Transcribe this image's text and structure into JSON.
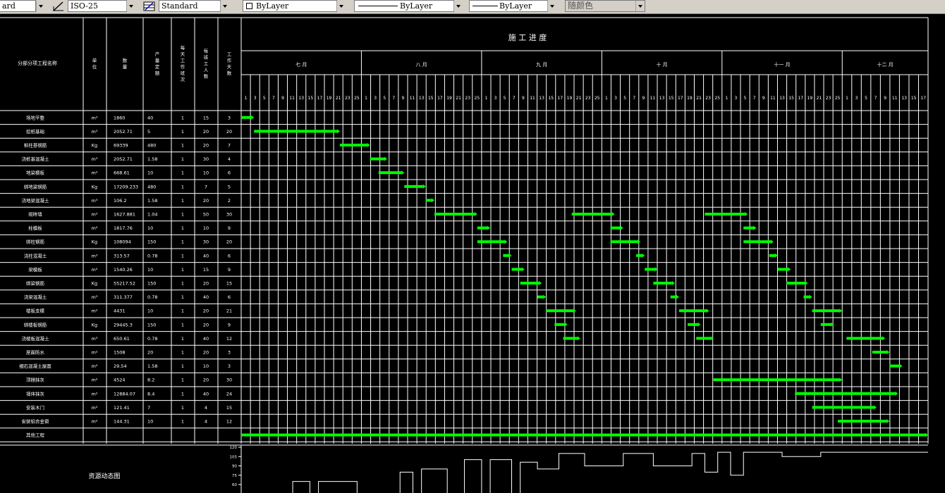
{
  "toolbar": {
    "text_style": "ard",
    "dim_style": "ISO-25",
    "table_style": "Standard",
    "layer": "ByLayer",
    "linetype": "ByLayer",
    "lineweight": "ByLayer",
    "color": "随颜色"
  },
  "schedule": {
    "title": "施 工 进 度",
    "headers": {
      "task": "分部分项工程名称",
      "unit": "单位",
      "qty": "数量",
      "rate": "产量定额",
      "shifts": "每天工作班次",
      "workers": "每班工人数",
      "days": "工作天数"
    },
    "months": [
      "七 月",
      "八 月",
      "九 月",
      "十 月",
      "十一 月",
      "十二 月"
    ],
    "day_labels": {
      "july": [
        "1",
        "3",
        "5",
        "7",
        "9",
        "11",
        "13",
        "15",
        "17",
        "19",
        "21",
        "23",
        "25"
      ],
      "aug": [
        "1",
        "3",
        "5",
        "7",
        "9",
        "11",
        "13",
        "15",
        "17",
        "19",
        "21",
        "23",
        "25"
      ],
      "sep": [
        "1",
        "3",
        "5",
        "7",
        "9",
        "11",
        "13",
        "15",
        "17",
        "19",
        "21",
        "23",
        "25"
      ],
      "oct": [
        "1",
        "3",
        "5",
        "7",
        "9",
        "11",
        "13",
        "15",
        "17",
        "19",
        "21",
        "23",
        "25"
      ],
      "nov": [
        "1",
        "3",
        "5",
        "7",
        "9",
        "11",
        "13",
        "15",
        "17",
        "19",
        "21",
        "23",
        "25"
      ],
      "dec": [
        "1",
        "3",
        "5",
        "7",
        "9",
        "11",
        "13",
        "15",
        "17"
      ]
    },
    "rows": [
      {
        "task": "场地平整",
        "unit": "m³",
        "qty": "1860",
        "rate": "40",
        "shifts": "1",
        "workers": "15",
        "days": "3"
      },
      {
        "task": "挖桩基础",
        "unit": "m³",
        "qty": "2052.71",
        "rate": "5",
        "shifts": "1",
        "workers": "20",
        "days": "20"
      },
      {
        "task": "桩柱基钢筋",
        "unit": "Kg",
        "qty": "69339",
        "rate": "480",
        "shifts": "1",
        "workers": "20",
        "days": "7"
      },
      {
        "task": "浇桩基混凝土",
        "unit": "m³",
        "qty": "2052.71",
        "rate": "1.58",
        "shifts": "1",
        "workers": "30",
        "days": "4"
      },
      {
        "task": "地梁模板",
        "unit": "m²",
        "qty": "668.61",
        "rate": "10",
        "shifts": "1",
        "workers": "10",
        "days": "6"
      },
      {
        "task": "绑地梁钢筋",
        "unit": "Kg",
        "qty": "17209.233",
        "rate": "480",
        "shifts": "1",
        "workers": "7",
        "days": "5"
      },
      {
        "task": "浇地梁混凝土",
        "unit": "m³",
        "qty": "106.2",
        "rate": "1.58",
        "shifts": "1",
        "workers": "20",
        "days": "2"
      },
      {
        "task": "砌砖墙",
        "unit": "m³",
        "qty": "1627.881",
        "rate": "1.04",
        "shifts": "1",
        "workers": "50",
        "days": "30"
      },
      {
        "task": "柱模板",
        "unit": "m²",
        "qty": "1817.76",
        "rate": "10",
        "shifts": "1",
        "workers": "10",
        "days": "9"
      },
      {
        "task": "绑柱钢筋",
        "unit": "Kg",
        "qty": "108094",
        "rate": "150",
        "shifts": "1",
        "workers": "30",
        "days": "20"
      },
      {
        "task": "浇柱混凝土",
        "unit": "m³",
        "qty": "313.57",
        "rate": "0.78",
        "shifts": "1",
        "workers": "40",
        "days": "6"
      },
      {
        "task": "梁模板",
        "unit": "m²",
        "qty": "1540.26",
        "rate": "10",
        "shifts": "1",
        "workers": "15",
        "days": "9"
      },
      {
        "task": "绑梁钢筋",
        "unit": "Kg",
        "qty": "55217.52",
        "rate": "150",
        "shifts": "1",
        "workers": "20",
        "days": "15"
      },
      {
        "task": "浇梁混凝土",
        "unit": "m³",
        "qty": "311.377",
        "rate": "0.78",
        "shifts": "1",
        "workers": "40",
        "days": "6"
      },
      {
        "task": "楼板支模",
        "unit": "m²",
        "qty": "4431",
        "rate": "10",
        "shifts": "1",
        "workers": "20",
        "days": "21"
      },
      {
        "task": "绑楼板钢筋",
        "unit": "Kg",
        "qty": "29445.3",
        "rate": "150",
        "shifts": "1",
        "workers": "20",
        "days": "9"
      },
      {
        "task": "浇楼板混凝土",
        "unit": "m³",
        "qty": "650.61",
        "rate": "0.78",
        "shifts": "1",
        "workers": "40",
        "days": "12"
      },
      {
        "task": "屋面防水",
        "unit": "m²",
        "qty": "1508",
        "rate": "20",
        "shifts": "1",
        "workers": "20",
        "days": "3"
      },
      {
        "task": "细石混凝土屋面",
        "unit": "m²",
        "qty": "29.54",
        "rate": "1.58",
        "shifts": "1",
        "workers": "10",
        "days": "3"
      },
      {
        "task": "顶棚抹灰",
        "unit": "m²",
        "qty": "4524",
        "rate": "8.2",
        "shifts": "1",
        "workers": "20",
        "days": "30"
      },
      {
        "task": "墙体抹灰",
        "unit": "m²",
        "qty": "12884.07",
        "rate": "8.4",
        "shifts": "1",
        "workers": "40",
        "days": "24"
      },
      {
        "task": "安装木门",
        "unit": "m²",
        "qty": "121.41",
        "rate": "7",
        "shifts": "1",
        "workers": "4",
        "days": "15"
      },
      {
        "task": "安装铝合金窗",
        "unit": "m²",
        "qty": "144.31",
        "rate": "10",
        "shifts": "1",
        "workers": "4",
        "days": "12"
      },
      {
        "task": "其他工程",
        "unit": "",
        "qty": "",
        "rate": "",
        "shifts": "",
        "workers": "",
        "days": ""
      }
    ],
    "bars": [
      [
        [
          0,
          3
        ]
      ],
      [
        [
          3,
          23
        ]
      ],
      [
        [
          23,
          30
        ]
      ],
      [
        [
          30,
          34
        ]
      ],
      [
        [
          32,
          38
        ]
      ],
      [
        [
          38,
          43
        ]
      ],
      [
        [
          43,
          45
        ]
      ],
      [
        [
          45,
          55
        ],
        [
          77,
          87
        ],
        [
          108,
          118
        ]
      ],
      [
        [
          55,
          58
        ],
        [
          86,
          89
        ],
        [
          117,
          120
        ]
      ],
      [
        [
          55,
          62
        ],
        [
          86,
          93
        ],
        [
          117,
          124
        ]
      ],
      [
        [
          61,
          63
        ],
        [
          92,
          94
        ],
        [
          123,
          125
        ]
      ],
      [
        [
          63,
          66
        ],
        [
          94,
          97
        ],
        [
          125,
          128
        ]
      ],
      [
        [
          65,
          70
        ],
        [
          96,
          101
        ],
        [
          127,
          132
        ]
      ],
      [
        [
          69,
          71
        ],
        [
          100,
          102
        ],
        [
          131,
          133
        ]
      ],
      [
        [
          71,
          78
        ],
        [
          102,
          109
        ],
        [
          133,
          140
        ]
      ],
      [
        [
          73,
          76
        ],
        [
          104,
          107
        ],
        [
          135,
          138
        ]
      ],
      [
        [
          75,
          79
        ],
        [
          106,
          110
        ],
        [
          141,
          150
        ]
      ],
      [
        [
          147,
          151
        ]
      ],
      [
        [
          151,
          154
        ]
      ],
      [
        [
          110,
          140
        ]
      ],
      [
        [
          129,
          153
        ]
      ],
      [
        [
          133,
          148
        ]
      ],
      [
        [
          139,
          151
        ]
      ],
      [
        [
          0,
          160
        ]
      ]
    ],
    "resource": {
      "label": "资源动态图",
      "y_ticks": [
        "120",
        "105",
        "90",
        "75",
        "60"
      ],
      "profile": [
        [
          0,
          0
        ],
        [
          12,
          65
        ],
        [
          16,
          0
        ],
        [
          18,
          65
        ],
        [
          27,
          0
        ],
        [
          37,
          80
        ],
        [
          40,
          0
        ],
        [
          42,
          85
        ],
        [
          48,
          0
        ],
        [
          52,
          100
        ],
        [
          56,
          0
        ],
        [
          58,
          100
        ],
        [
          63,
          0
        ],
        [
          65,
          96
        ],
        [
          69,
          85
        ],
        [
          74,
          110
        ],
        [
          80,
          90
        ],
        [
          89,
          110
        ],
        [
          96,
          90
        ],
        [
          105,
          110
        ],
        [
          108,
          80
        ],
        [
          111,
          112
        ],
        [
          114,
          75
        ],
        [
          117,
          112
        ],
        [
          120,
          112
        ],
        [
          126,
          105
        ],
        [
          135,
          112
        ],
        [
          150,
          112
        ],
        [
          160,
          112
        ]
      ]
    },
    "accent": "#00ff00",
    "line_color": "#ffffff"
  }
}
